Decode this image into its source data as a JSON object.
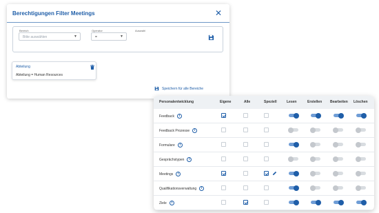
{
  "dialog": {
    "title": "Berechtigungen Filter Meetings",
    "close_icon": "close-icon",
    "filter": {
      "bereich_label": "Bereich",
      "bereich_placeholder": "Bitte auswählen",
      "operator_label": "Operator",
      "operator_value": "=",
      "auswahl_label": "Auswahl",
      "save_icon": "floppy-disk-icon"
    },
    "card": {
      "title": "Abteilung",
      "value": "Abteilung  =  Human Resources",
      "delete_icon": "trash-icon"
    },
    "save_all_label": "Speichern für alle Bereiche"
  },
  "permissions": {
    "columns": [
      "Personalentwicklung",
      "Eigene",
      "Alle",
      "Speziell",
      "Lesen",
      "Erstellen",
      "Bearbeiten",
      "Löschen"
    ],
    "rows": [
      {
        "name": "Feedback",
        "eigene": true,
        "alle": false,
        "speziell": false,
        "edit": false,
        "lesen": true,
        "erstellen": true,
        "bearbeiten": true,
        "loeschen": true
      },
      {
        "name": "Feedback Prozesse",
        "eigene": false,
        "alle": false,
        "speziell": false,
        "edit": false,
        "lesen": false,
        "erstellen": false,
        "bearbeiten": false,
        "loeschen": false
      },
      {
        "name": "Formulare",
        "eigene": false,
        "alle": false,
        "speziell": false,
        "edit": false,
        "lesen": true,
        "erstellen": false,
        "bearbeiten": false,
        "loeschen": false
      },
      {
        "name": "Gesprächstypen",
        "eigene": false,
        "alle": false,
        "speziell": false,
        "edit": false,
        "lesen": false,
        "erstellen": false,
        "bearbeiten": false,
        "loeschen": false
      },
      {
        "name": "Meetings",
        "eigene": true,
        "alle": false,
        "speziell": true,
        "edit": true,
        "lesen": true,
        "erstellen": false,
        "bearbeiten": false,
        "loeschen": false
      },
      {
        "name": "Qualifikationsverwaltung",
        "eigene": false,
        "alle": false,
        "speziell": false,
        "edit": false,
        "lesen": true,
        "erstellen": false,
        "bearbeiten": false,
        "loeschen": false
      },
      {
        "name": "Ziele",
        "eigene": false,
        "alle": true,
        "speziell": false,
        "edit": false,
        "lesen": true,
        "erstellen": true,
        "bearbeiten": true,
        "loeschen": true
      }
    ]
  },
  "colors": {
    "primary": "#1f5ea8",
    "toggle_on_track": "#6f9dd6",
    "toggle_off": "#d9dde1"
  }
}
